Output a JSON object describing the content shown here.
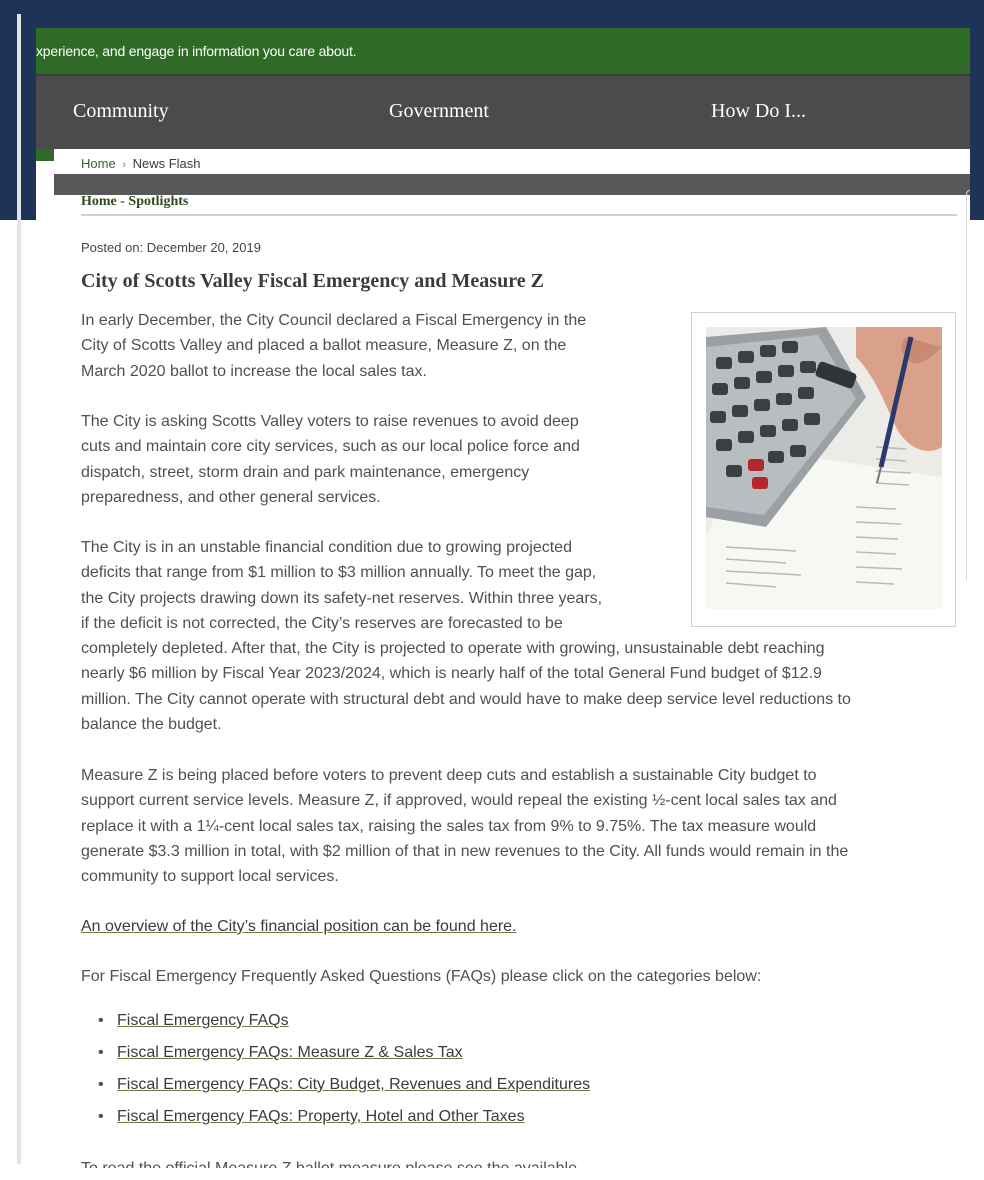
{
  "banner": {
    "text": "xperience, and engage in information you care about."
  },
  "nav": {
    "items": [
      {
        "label": "Community"
      },
      {
        "label": "Government"
      },
      {
        "label": "How Do I..."
      }
    ]
  },
  "breadcrumb": {
    "home": "Home",
    "separator": "›",
    "current": "News Flash"
  },
  "section": {
    "title": "Home - Spotlights"
  },
  "article": {
    "posted": "Posted on: December 20, 2019",
    "title": "City of Scotts Valley Fiscal Emergency and Measure Z",
    "p1": [
      "In early December, the City Council declared a Fiscal Emergency in the",
      "City of Scotts Valley and placed a ballot measure, Measure Z, on the",
      "March 2020 ballot to increase the local sales tax."
    ],
    "p2": [
      "The City is asking Scotts Valley voters to raise revenues to avoid deep",
      "cuts and maintain core city services, such as our local police force and",
      "dispatch, street, storm drain and park maintenance, emergency",
      "preparedness, and other general services."
    ],
    "p3": [
      "The City is in an unstable financial condition due to growing projected",
      "deficits that range from $1 million to $3 million annually. To meet the gap,",
      "the City projects drawing down its safety-net reserves. Within three years,",
      "if the deficit is not corrected, the City’s reserves are forecasted to be",
      "completely depleted. After that, the City is projected to operate with growing, unsustainable debt reaching",
      "nearly $6 million by Fiscal Year 2023/2024, which is nearly half of the total General Fund budget of $12.9",
      "million. The City cannot operate with structural debt and would have to make deep service level reductions to",
      "balance the budget."
    ],
    "p4": [
      "Measure Z is being placed before voters to prevent deep cuts and establish a sustainable City budget to",
      "support current service levels. Measure Z, if approved, would repeal the existing ½-cent local sales tax and",
      "replace it with a 1¼-cent local sales tax, raising the sales tax from 9% to 9.75%. The tax measure would",
      "generate $3.3 million in total, with $2 million of that in new revenues to the City. All funds would remain in the",
      "community to support local services."
    ],
    "overview_link": "An overview of the City’s financial position can be found here.",
    "faq_intro": "For Fiscal Emergency Frequently Asked Questions (FAQs) please click on the categories below:",
    "faq_links": [
      "Fiscal Emergency FAQs",
      "Fiscal Emergency FAQs:  Measure Z & Sales Tax",
      "Fiscal Emergency FAQs:  City Budget, Revenues and Expenditures",
      "Fiscal Emergency FAQs:  Property, Hotel and Other Taxes"
    ],
    "cutoff_line": "To read the official Measure Z ballot measure please see the available"
  },
  "icons": {
    "photo": "calculator-photo",
    "bullet": "bullet-icon"
  },
  "colors": {
    "brand_green": "#2f6b27",
    "nav_gray": "#4b4b4b",
    "outer_navy": "#1f3258"
  }
}
